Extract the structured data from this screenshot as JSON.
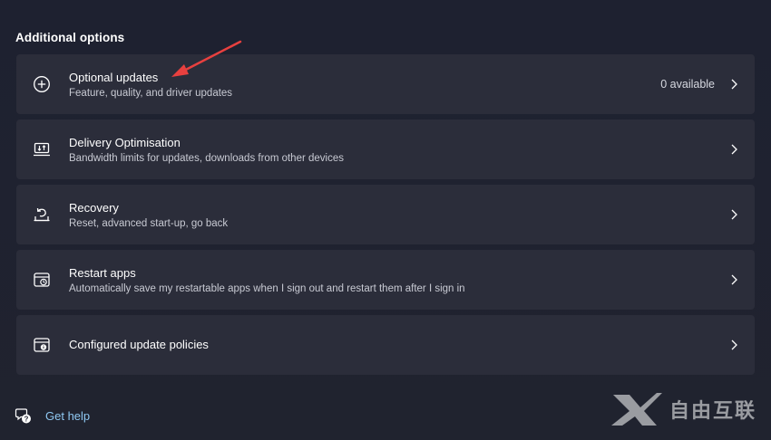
{
  "section": {
    "title": "Additional options"
  },
  "cards": [
    {
      "icon": "plus-circle-icon",
      "title": "Optional updates",
      "subtitle": "Feature, quality, and driver updates",
      "status": "0 available"
    },
    {
      "icon": "delivery-optimisation-icon",
      "title": "Delivery Optimisation",
      "subtitle": "Bandwidth limits for updates, downloads from other devices"
    },
    {
      "icon": "recovery-icon",
      "title": "Recovery",
      "subtitle": "Reset, advanced start-up, go back"
    },
    {
      "icon": "restart-apps-icon",
      "title": "Restart apps",
      "subtitle": "Automatically save my restartable apps when I sign out and restart them after I sign in"
    },
    {
      "icon": "policy-icon",
      "title": "Configured update policies"
    }
  ],
  "help": {
    "label": "Get help",
    "icon": "help-chat-icon"
  },
  "colors": {
    "background": "#1f2230",
    "card": "#2b2d3a",
    "link": "#8fc8f2",
    "annotation_arrow": "#e8403f"
  },
  "watermark": {
    "text": "自由互联"
  }
}
